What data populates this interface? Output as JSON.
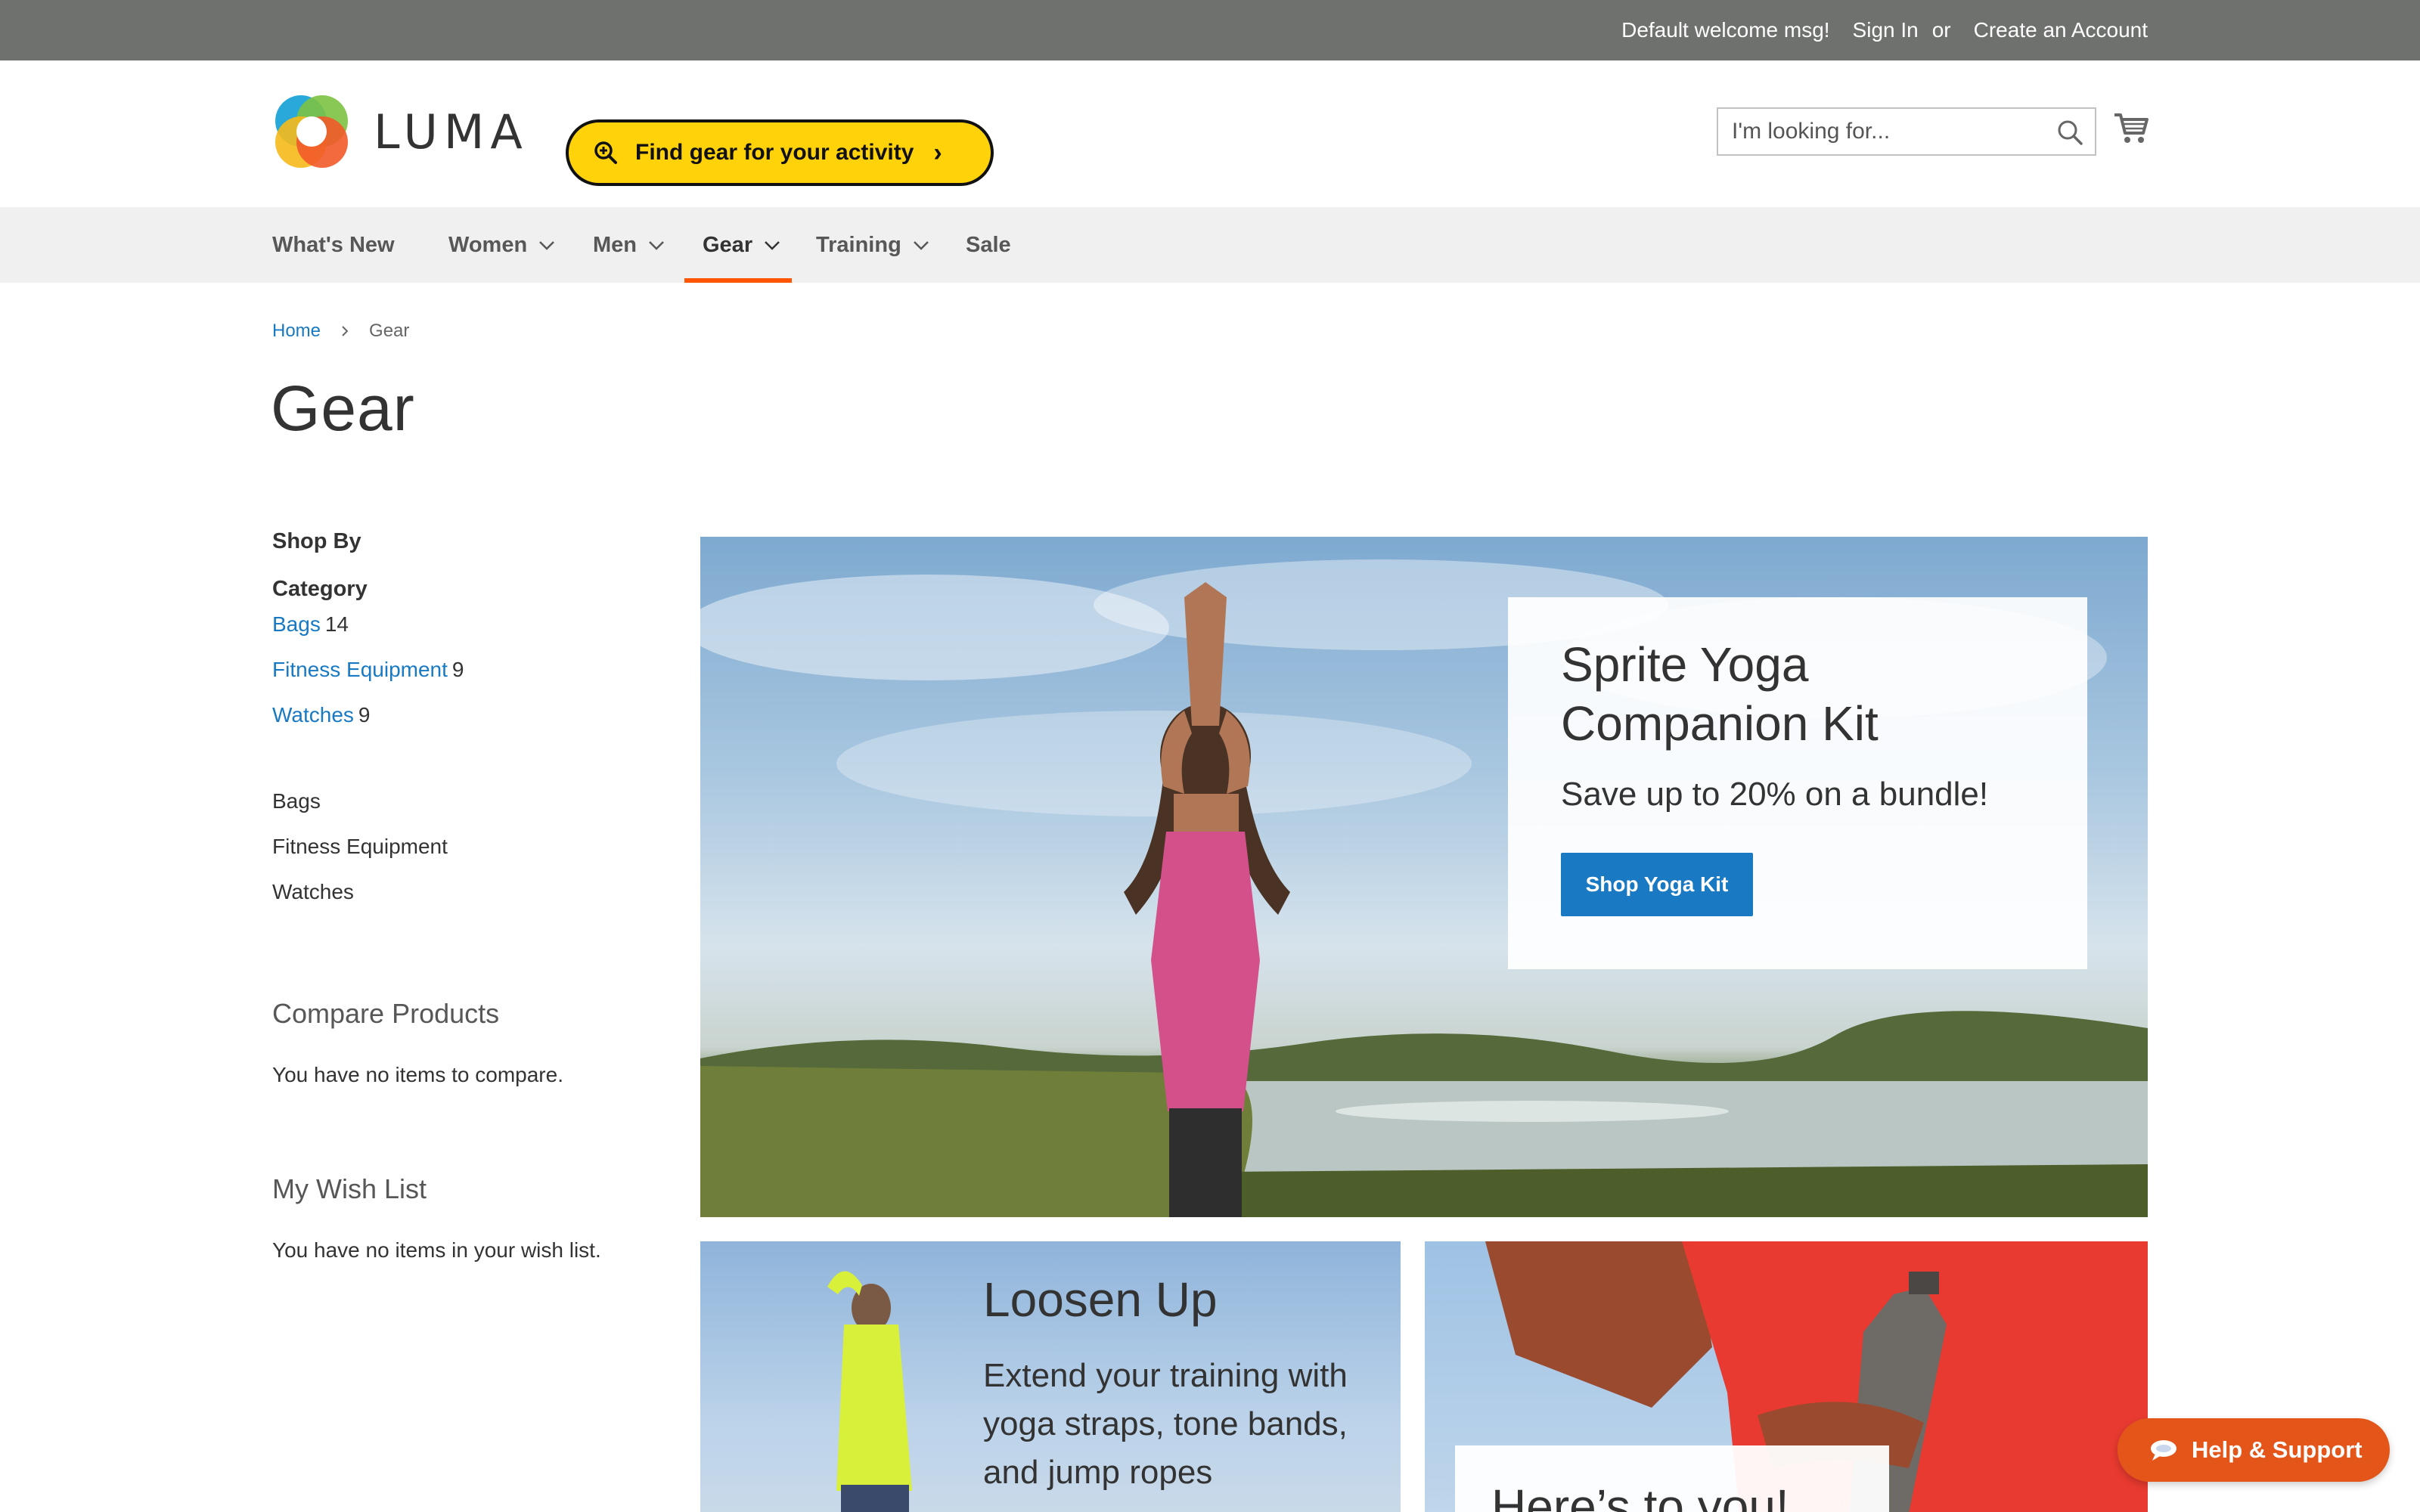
{
  "top_panel": {
    "welcome": "Default welcome msg!",
    "sign_in": "Sign In",
    "or": "or",
    "create_account": "Create an Account"
  },
  "header": {
    "logo_text": "LUMA",
    "find_gear_label": "Find gear for your activity",
    "find_gear_arrow": "›",
    "search_placeholder": "I'm looking for...",
    "colors": {
      "find_gear_bg": "#ffd20a",
      "accent": "#ff5501",
      "link": "#1979c3"
    }
  },
  "nav": {
    "items": [
      {
        "label": "What's New",
        "has_dropdown": false,
        "active": false
      },
      {
        "label": "Women",
        "has_dropdown": true,
        "active": false
      },
      {
        "label": "Men",
        "has_dropdown": true,
        "active": false
      },
      {
        "label": "Gear",
        "has_dropdown": true,
        "active": true
      },
      {
        "label": "Training",
        "has_dropdown": true,
        "active": false
      },
      {
        "label": "Sale",
        "has_dropdown": false,
        "active": false
      }
    ]
  },
  "breadcrumb": {
    "home": "Home",
    "current": "Gear"
  },
  "page_title": "Gear",
  "sidebar": {
    "shop_by": "Shop By",
    "category_title": "Category",
    "filters": [
      {
        "label": "Bags",
        "count": "14"
      },
      {
        "label": "Fitness Equipment",
        "count": "9"
      },
      {
        "label": "Watches",
        "count": "9"
      }
    ],
    "categories": [
      "Bags",
      "Fitness Equipment",
      "Watches"
    ],
    "compare": {
      "title": "Compare Products",
      "empty": "You have no items to compare."
    },
    "wishlist": {
      "title": "My Wish List",
      "empty": "You have no items in your wish list."
    }
  },
  "hero": {
    "title": "Sprite Yoga Companion Kit",
    "subtitle": "Save up to 20% on a bundle!",
    "button": "Shop Yoga Kit"
  },
  "tiles": {
    "left": {
      "title": "Loosen Up",
      "text": "Extend your training with yoga straps, tone bands, and jump ropes"
    },
    "right": {
      "title": "Here’s to you!"
    }
  },
  "help": {
    "label": "Help & Support",
    "color": "#e4551a"
  }
}
